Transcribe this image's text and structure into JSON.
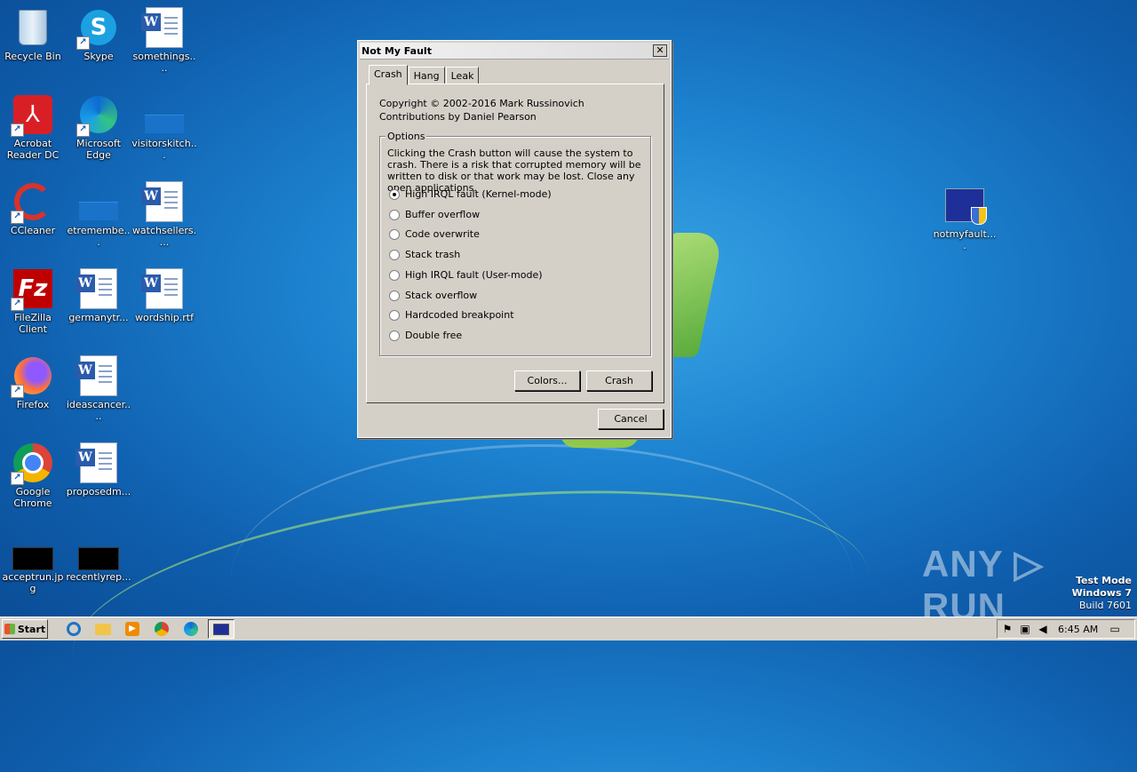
{
  "desktop": {
    "icons": [
      {
        "label": "Recycle Bin"
      },
      {
        "label": "Skype"
      },
      {
        "label": "somethings...."
      },
      {
        "label": "Acrobat Reader DC"
      },
      {
        "label": "Microsoft Edge"
      },
      {
        "label": "visitorskitch..."
      },
      {
        "label": "CCleaner"
      },
      {
        "label": "etremembe..."
      },
      {
        "label": "watchsellers...."
      },
      {
        "label": "FileZilla Client"
      },
      {
        "label": "germanytr..."
      },
      {
        "label": "wordship.rtf"
      },
      {
        "label": "Firefox"
      },
      {
        "label": "ideascancer...."
      },
      {
        "label": "Google Chrome"
      },
      {
        "label": "proposedm..."
      },
      {
        "label": "acceptrun.jpg"
      },
      {
        "label": "recentlyrep..."
      },
      {
        "label": "notmyfault...."
      }
    ]
  },
  "dialog": {
    "title": "Not My Fault",
    "close_glyph": "✕",
    "tabs": [
      {
        "label": "Crash"
      },
      {
        "label": "Hang"
      },
      {
        "label": "Leak"
      }
    ],
    "copyright": "Copyright © 2002-2016 Mark Russinovich",
    "contributions": "Contributions by Daniel Pearson",
    "options_title": "Options",
    "description": "Clicking the Crash button will cause the system to crash. There is a risk that corrupted memory will be written to disk or that work may be lost. Close any open applications.",
    "options": [
      {
        "label": "High IRQL fault (Kernel-mode)",
        "selected": true
      },
      {
        "label": "Buffer overflow",
        "selected": false
      },
      {
        "label": "Code overwrite",
        "selected": false
      },
      {
        "label": "Stack trash",
        "selected": false
      },
      {
        "label": "High IRQL fault (User-mode)",
        "selected": false
      },
      {
        "label": "Stack overflow",
        "selected": false
      },
      {
        "label": "Hardcoded breakpoint",
        "selected": false
      },
      {
        "label": "Double free",
        "selected": false
      }
    ],
    "colors_button": "Colors...",
    "crash_button": "Crash",
    "cancel_button": "Cancel"
  },
  "watermark": {
    "text": "ANY ▷ RUN",
    "test_mode": "Test Mode",
    "os": "Windows 7",
    "build": "Build 7601"
  },
  "taskbar": {
    "start_label": "Start",
    "clock": "6:45 AM"
  }
}
